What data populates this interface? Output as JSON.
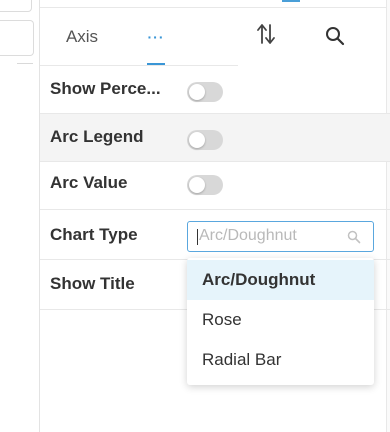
{
  "tabs": {
    "axis_label": "Axis",
    "more_label": "···"
  },
  "toolbar": {
    "sort_icon": "sort-arrows-icon",
    "search_icon": "search-icon"
  },
  "properties": [
    {
      "label": "Show Perce...",
      "type": "toggle",
      "on": false
    },
    {
      "label": "Arc Legend",
      "type": "toggle",
      "on": false
    },
    {
      "label": "Arc Value",
      "type": "toggle",
      "on": false
    },
    {
      "label": "Chart Type",
      "type": "select"
    },
    {
      "label": "Show Title",
      "type": "toggle",
      "on": false
    }
  ],
  "chart_type_select": {
    "placeholder": "Arc/Doughnut",
    "options": [
      "Arc/Doughnut",
      "Rose",
      "Radial Bar"
    ],
    "highlighted": "Arc/Doughnut"
  },
  "colors": {
    "accent": "#3a96d6",
    "toggle_off": "#d8d8d8",
    "highlight_bg": "#e6f4fb"
  }
}
